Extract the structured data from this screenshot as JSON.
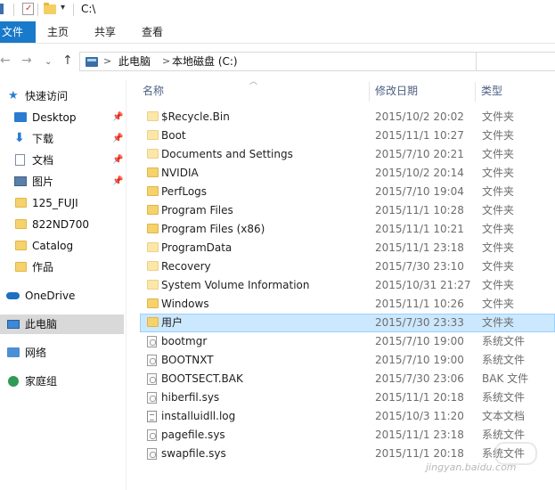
{
  "window": {
    "title": "C:\\"
  },
  "ribbon": {
    "tabs": [
      {
        "label": "文件"
      },
      {
        "label": "主页"
      },
      {
        "label": "共享"
      },
      {
        "label": "查看"
      }
    ]
  },
  "address": {
    "crumbs": [
      "此电脑",
      "本地磁盘 (C:)"
    ],
    "separator": ">"
  },
  "nav_pane": {
    "items": [
      {
        "label": "快速访问",
        "icon": "star-icon"
      },
      {
        "label": "Desktop",
        "icon": "desktop-icon",
        "pinned": true
      },
      {
        "label": "下载",
        "icon": "download-icon",
        "pinned": true
      },
      {
        "label": "文档",
        "icon": "document-icon",
        "pinned": true
      },
      {
        "label": "图片",
        "icon": "picture-icon",
        "pinned": true
      },
      {
        "label": "125_FUJI",
        "icon": "folder-icon"
      },
      {
        "label": "822ND700",
        "icon": "folder-icon"
      },
      {
        "label": "Catalog",
        "icon": "folder-icon"
      },
      {
        "label": "作品",
        "icon": "folder-icon"
      },
      {
        "label": "OneDrive",
        "icon": "cloud-icon"
      },
      {
        "label": "此电脑",
        "icon": "computer-icon",
        "selected": true
      },
      {
        "label": "网络",
        "icon": "network-icon"
      },
      {
        "label": "家庭组",
        "icon": "homegroup-icon"
      }
    ]
  },
  "columns": {
    "name": "名称",
    "date": "修改日期",
    "type": "类型"
  },
  "files": [
    {
      "name": "$Recycle.Bin",
      "date": "2015/10/2 20:02",
      "type": "文件夹",
      "icon": "folder-light"
    },
    {
      "name": "Boot",
      "date": "2015/11/1 10:27",
      "type": "文件夹",
      "icon": "folder-light"
    },
    {
      "name": "Documents and Settings",
      "date": "2015/7/10 20:21",
      "type": "文件夹",
      "icon": "folder-light"
    },
    {
      "name": "NVIDIA",
      "date": "2015/10/2 20:14",
      "type": "文件夹",
      "icon": "folder"
    },
    {
      "name": "PerfLogs",
      "date": "2015/7/10 19:04",
      "type": "文件夹",
      "icon": "folder"
    },
    {
      "name": "Program Files",
      "date": "2015/11/1 10:28",
      "type": "文件夹",
      "icon": "folder"
    },
    {
      "name": "Program Files (x86)",
      "date": "2015/11/1 10:21",
      "type": "文件夹",
      "icon": "folder"
    },
    {
      "name": "ProgramData",
      "date": "2015/11/1 23:18",
      "type": "文件夹",
      "icon": "folder-light"
    },
    {
      "name": "Recovery",
      "date": "2015/7/30 23:10",
      "type": "文件夹",
      "icon": "folder-light"
    },
    {
      "name": "System Volume Information",
      "date": "2015/10/31 21:27",
      "type": "文件夹",
      "icon": "folder-light"
    },
    {
      "name": "Windows",
      "date": "2015/11/1 10:26",
      "type": "文件夹",
      "icon": "folder"
    },
    {
      "name": "用户",
      "date": "2015/7/30 23:33",
      "type": "文件夹",
      "icon": "folder",
      "selected": true
    },
    {
      "name": "bootmgr",
      "date": "2015/7/10 19:00",
      "type": "系统文件",
      "icon": "system-file"
    },
    {
      "name": "BOOTNXT",
      "date": "2015/7/10 19:00",
      "type": "系统文件",
      "icon": "system-file"
    },
    {
      "name": "BOOTSECT.BAK",
      "date": "2015/7/30 23:06",
      "type": "BAK 文件",
      "icon": "system-file"
    },
    {
      "name": "hiberfil.sys",
      "date": "2015/11/1 20:18",
      "type": "系统文件",
      "icon": "system-file"
    },
    {
      "name": "installuidll.log",
      "date": "2015/10/3 11:20",
      "type": "文本文档",
      "icon": "text-file"
    },
    {
      "name": "pagefile.sys",
      "date": "2015/11/1 23:18",
      "type": "系统文件",
      "icon": "system-file"
    },
    {
      "name": "swapfile.sys",
      "date": "2015/11/1 20:18",
      "type": "系统文件",
      "icon": "system-file"
    }
  ],
  "watermark": "jingyan.baidu.com"
}
